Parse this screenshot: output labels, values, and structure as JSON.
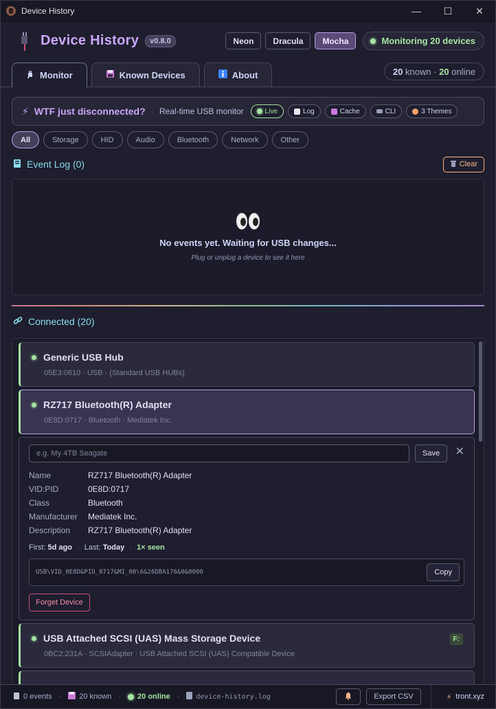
{
  "window": {
    "title": "Device History",
    "minimize": "—",
    "maximize": "☐",
    "close": "✕"
  },
  "header": {
    "title": "Device History",
    "version": "v0.8.0",
    "themes": [
      "Neon",
      "Dracula",
      "Mocha"
    ],
    "active_theme": "Mocha",
    "monitoring": "Monitoring 20 devices"
  },
  "tabs": [
    {
      "label": "Monitor",
      "icon": "plug-icon",
      "active": true
    },
    {
      "label": "Known Devices",
      "icon": "floppy-icon",
      "active": false
    },
    {
      "label": "About",
      "icon": "info-icon",
      "active": false
    }
  ],
  "counts": {
    "known_num": "20",
    "known_label": "known",
    "dot": "·",
    "online_num": "20",
    "online_label": "online"
  },
  "banner": {
    "title": "WTF just disconnected?",
    "subtitle": "Real-time USB monitor",
    "pills": [
      "Live",
      "Log",
      "Cache",
      "CLI",
      "3 Themes"
    ]
  },
  "filters": [
    "All",
    "Storage",
    "HID",
    "Audio",
    "Bluetooth",
    "Network",
    "Other"
  ],
  "event_log": {
    "title": "Event Log (0)",
    "clear_label": "Clear",
    "empty_title": "No events yet. Waiting for USB changes...",
    "empty_sub": "Plug or unplug a device to see it here"
  },
  "connected": {
    "title": "Connected (20)",
    "devices": [
      {
        "name": "Generic USB Hub",
        "meta": "05E3:0610  ·  USB  ·  (Standard USB HUBs)"
      },
      {
        "name": "RZ717 Bluetooth(R) Adapter",
        "meta": "0E8D:0717  ·  Bluetooth  ·  Mediatek Inc."
      },
      {
        "name": "USB Attached SCSI (UAS) Mass Storage Device",
        "meta": "0BC2:231A  ·  SCSIAdapter  ·  USB Attached SCSI (UAS) Compatible Device",
        "drive": "F:"
      }
    ]
  },
  "details": {
    "placeholder": "e.g. My 4TB Seagate",
    "save_label": "Save",
    "close": "✕",
    "rows": [
      {
        "k": "Name",
        "v": "RZ717 Bluetooth(R) Adapter"
      },
      {
        "k": "VID:PID",
        "v": "0E8D:0717"
      },
      {
        "k": "Class",
        "v": "Bluetooth"
      },
      {
        "k": "Manufacturer",
        "v": "Mediatek Inc."
      },
      {
        "k": "Description",
        "v": "RZ717 Bluetooth(R) Adapter"
      }
    ],
    "first_label": "First:",
    "first_value": "5d ago",
    "last_label": "Last:",
    "last_value": "Today",
    "seen": "1× seen",
    "instance_path": "USB\\VID_0E8D&PID_0717&MI_00\\6&26DBA176&0&0000",
    "copy_label": "Copy",
    "forget_label": "Forget Device"
  },
  "statusbar": {
    "events": "0 events",
    "known": "20 known",
    "online": "20 online",
    "log_file": "device-history.log",
    "export_label": "Export CSV",
    "credit": "tront.xyz"
  },
  "colors": {
    "accent": "#cba6f7",
    "online": "#a6e3a1",
    "warn": "#fab387",
    "danger": "#f38ba8",
    "background": "#1e1e2e"
  }
}
